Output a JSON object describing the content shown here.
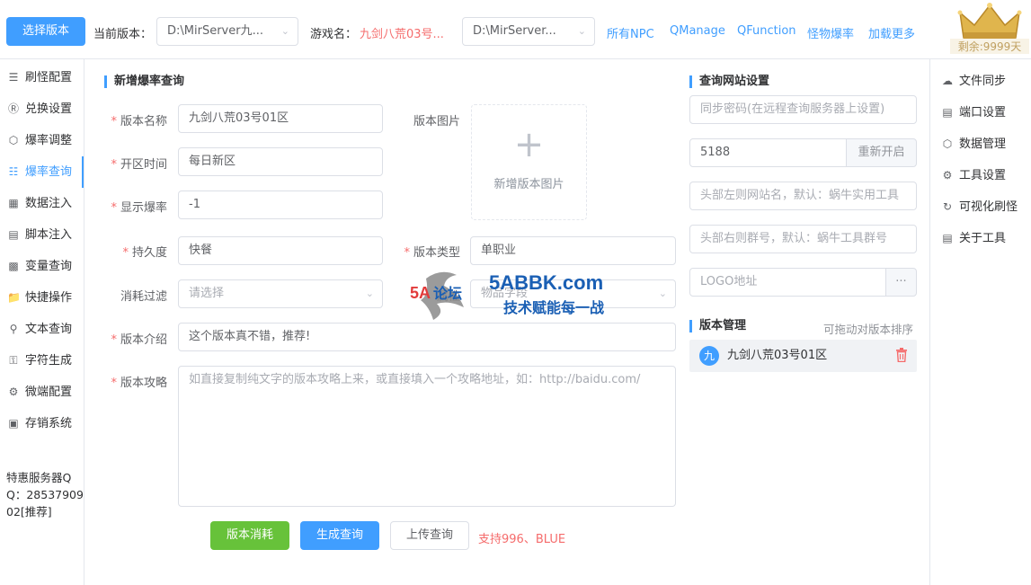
{
  "topbar": {
    "select_version_button": "选择版本",
    "current_version_label": "当前版本：",
    "current_version_value": "D:\\MirServer九...",
    "game_name_label": "游戏名：",
    "game_name_value": "九剑八荒03号...",
    "second_path_value": "D:\\MirServer...",
    "links": [
      "所有NPC",
      "QManage",
      "QFunction",
      "怪物爆率",
      "加载更多"
    ],
    "remaining": "剩余:9999天"
  },
  "leftnav": {
    "items": [
      "刷怪配置",
      "兑换设置",
      "爆率调整",
      "爆率查询",
      "数据注入",
      "脚本注入",
      "变量查询",
      "快捷操作",
      "文本查询",
      "字符生成",
      "微端配置",
      "存销系统"
    ],
    "active_index": 3,
    "promo": "特惠服务器QQ：2853790902[推荐]"
  },
  "form": {
    "title": "新增爆率查询",
    "version_name_label": "版本名称",
    "version_name_value": "九剑八荒03号01区",
    "version_image_label": "版本图片",
    "upload_text": "新增版本图片",
    "open_time_label": "开区时间",
    "open_time_value": "每日新区",
    "display_rate_label": "显示爆率",
    "display_rate_value": "-1",
    "durability_label": "持久度",
    "durability_value": "快餐",
    "version_type_label": "版本类型",
    "version_type_value": "单职业",
    "consume_filter_label": "消耗过滤",
    "consume_filter_placeholder": "请选择",
    "attribute_label": "属性",
    "attribute_value": "物品字段",
    "intro_label": "版本介绍",
    "intro_value": "这个版本真不错，推荐!",
    "guide_label": "版本攻略",
    "guide_placeholder": "如直接复制纯文字的版本攻略上来，或直接填入一个攻略地址，如：http://baidu.com/",
    "btn_version_consume": "版本消耗",
    "btn_generate": "生成查询",
    "btn_upload": "上传查询",
    "support_text": "支持996、BLUE"
  },
  "site_settings": {
    "title": "查询网站设置",
    "sync_password_placeholder": "同步密码(在远程查询服务器上设置)",
    "port_value": "5188",
    "restart_button": "重新开启",
    "left_site_placeholder": "头部左则网站名，默认：蜗牛实用工具",
    "right_group_placeholder": "头部右则群号，默认：蜗牛工具群号",
    "logo_placeholder": "LOGO地址",
    "logo_button": "···"
  },
  "version_mgmt": {
    "title": "版本管理",
    "hint": "可拖动对版本排序",
    "items": [
      {
        "avatar": "九",
        "name": "九剑八荒03号01区"
      }
    ]
  },
  "rightnav": {
    "items": [
      "文件同步",
      "端口设置",
      "数据管理",
      "工具设置",
      "可视化刷怪",
      "关于工具"
    ]
  },
  "watermark": {
    "site": "5ABBK.com",
    "slogan": "技术赋能每一战",
    "forum": "5A论坛"
  },
  "colors": {
    "primary": "#409eff",
    "success": "#67c23a",
    "danger": "#f56c6c",
    "gold": "#d4a64a"
  }
}
